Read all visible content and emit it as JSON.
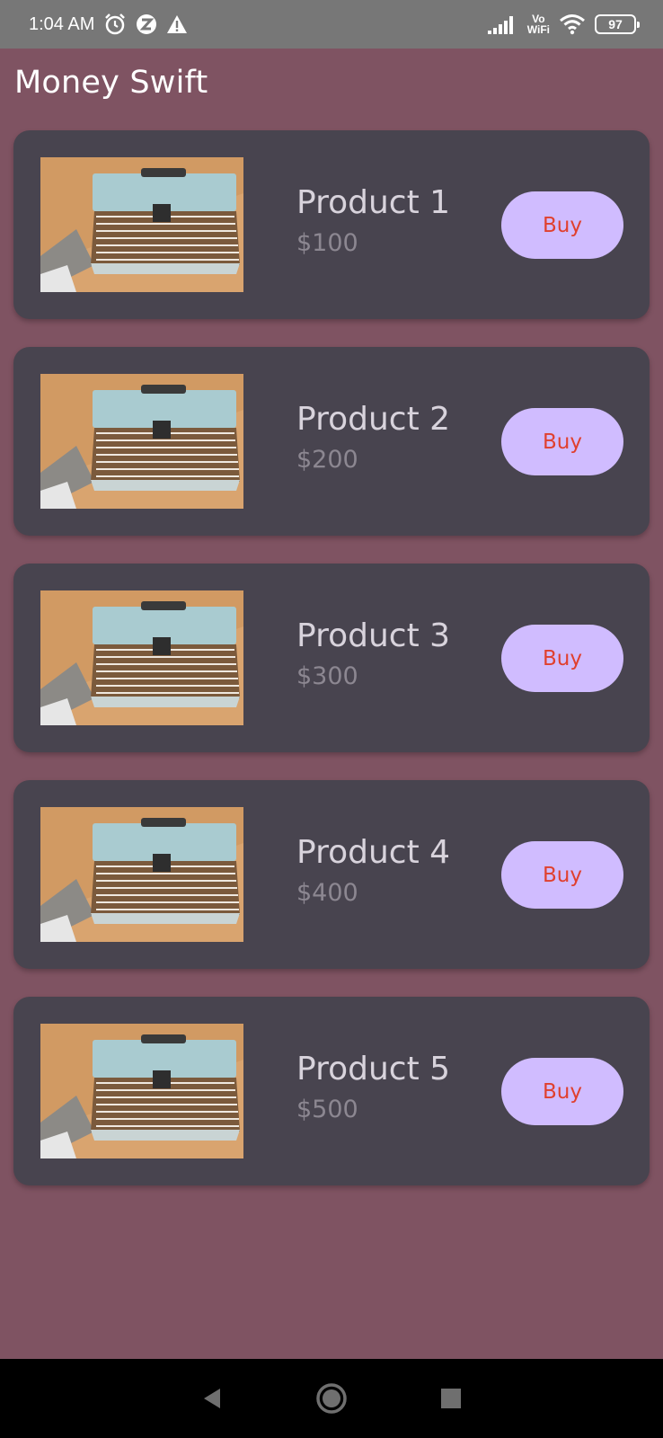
{
  "status_bar": {
    "time": "1:04 AM",
    "left_icons": [
      "alarm-icon",
      "zapp-notification-icon",
      "warning-icon"
    ],
    "network_label_top": "Vo",
    "network_label_bottom": "WiFi",
    "battery": "97"
  },
  "app": {
    "title": "Money Swift"
  },
  "products": [
    {
      "name": "Product 1",
      "price": "$100",
      "button": "Buy"
    },
    {
      "name": "Product 2",
      "price": "$200",
      "button": "Buy"
    },
    {
      "name": "Product 3",
      "price": "$300",
      "button": "Buy"
    },
    {
      "name": "Product 4",
      "price": "$400",
      "button": "Buy"
    },
    {
      "name": "Product 5",
      "price": "$500",
      "button": "Buy"
    }
  ],
  "nav": {
    "buttons": [
      "back-icon",
      "home-icon",
      "recents-icon"
    ]
  },
  "colors": {
    "background": "#7f5362",
    "card": "#48444f",
    "button": "#d0bcff",
    "button_text": "#e0402e"
  }
}
